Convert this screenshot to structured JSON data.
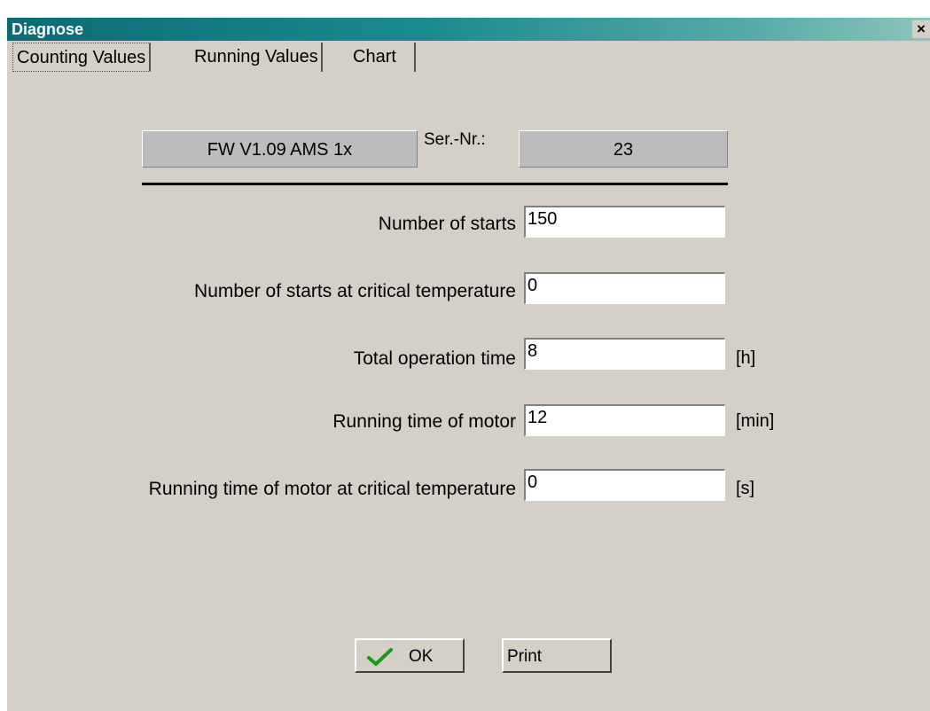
{
  "window": {
    "title": "Diagnose",
    "close_label": "×"
  },
  "tabs": [
    {
      "label": "Counting Values",
      "active": true
    },
    {
      "label": "Running Values",
      "active": false
    },
    {
      "label": "Chart",
      "active": false
    }
  ],
  "firmware": {
    "label": "FW  V1.09  AMS 1x",
    "serial_label": "Ser.-Nr.:",
    "serial_value": "23"
  },
  "fields": [
    {
      "label": "Number of starts",
      "value": "150",
      "unit": ""
    },
    {
      "label": "Number of starts at critical temperature",
      "value": "0",
      "unit": ""
    },
    {
      "label": "Total operation time",
      "value": "8",
      "unit": "[h]"
    },
    {
      "label": "Running time of motor",
      "value": "12",
      "unit": "[min]"
    },
    {
      "label": "Running time of motor at critical temperature",
      "value": "0",
      "unit": "[s]"
    }
  ],
  "buttons": {
    "ok": "OK",
    "print": "Print"
  },
  "icons": {
    "ok": "check-icon",
    "close": "close-icon"
  },
  "colors": {
    "titlebar_start": "#0a6b73",
    "titlebar_end": "#8cc5bd",
    "panel": "#d4d0c8",
    "check": "#1a9a1a"
  }
}
